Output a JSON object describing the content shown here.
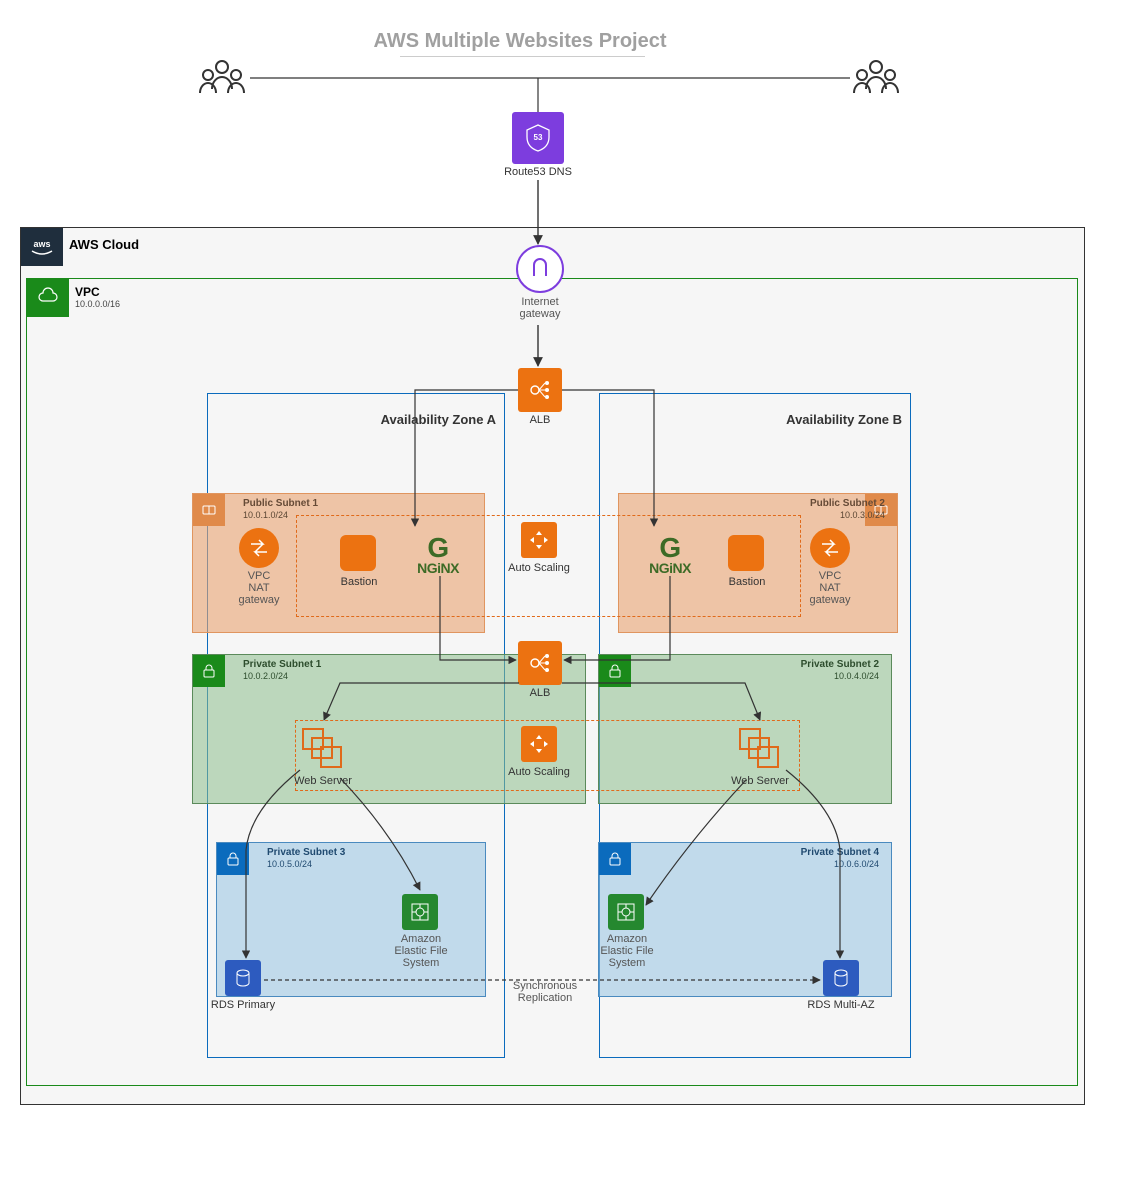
{
  "title": "AWS Multiple Websites Project",
  "users_left_label": "",
  "users_right_label": "",
  "route53": {
    "label": "Route53 DNS"
  },
  "aws_cloud": {
    "label": "AWS Cloud"
  },
  "vpc": {
    "label": "VPC",
    "cidr": "10.0.0.0/16"
  },
  "internet_gateway": {
    "line1": "Internet",
    "line2": "gateway"
  },
  "alb1": {
    "label": "ALB"
  },
  "alb2": {
    "label": "ALB"
  },
  "auto_scaling1": {
    "label": "Auto Scaling"
  },
  "auto_scaling2": {
    "label": "Auto Scaling"
  },
  "az_a": "Availability Zone A",
  "az_b": "Availability Zone B",
  "public_subnet_1": {
    "title": "Public Subnet 1",
    "cidr": "10.0.1.0/24"
  },
  "public_subnet_2": {
    "title": "Public Subnet 2",
    "cidr": "10.0.3.0/24"
  },
  "private_subnet_1": {
    "title": "Private Subnet 1",
    "cidr": "10.0.2.0/24"
  },
  "private_subnet_2": {
    "title": "Private Subnet 2",
    "cidr": "10.0.4.0/24"
  },
  "private_subnet_3": {
    "title": "Private Subnet 3",
    "cidr": "10.0.5.0/24"
  },
  "private_subnet_4": {
    "title": "Private Subnet 4",
    "cidr": "10.0.6.0/24"
  },
  "nat1": {
    "line1": "VPC",
    "line2": "NAT",
    "line3": "gateway"
  },
  "nat2": {
    "line1": "VPC",
    "line2": "NAT",
    "line3": "gateway"
  },
  "bastion1": "Bastion",
  "bastion2": "Bastion",
  "nginx_text": "NGiNX",
  "web_server1": "Web Server",
  "web_server2": "Web Server",
  "efs1": {
    "line1": "Amazon",
    "line2": "Elastic File",
    "line3": "System"
  },
  "efs2": {
    "line1": "Amazon",
    "line2": "Elastic File",
    "line3": "System"
  },
  "rds_primary": "RDS Primary",
  "rds_multi": "RDS Multi-AZ",
  "sync_repl": {
    "line1": "Synchronous",
    "line2": "Replication"
  }
}
